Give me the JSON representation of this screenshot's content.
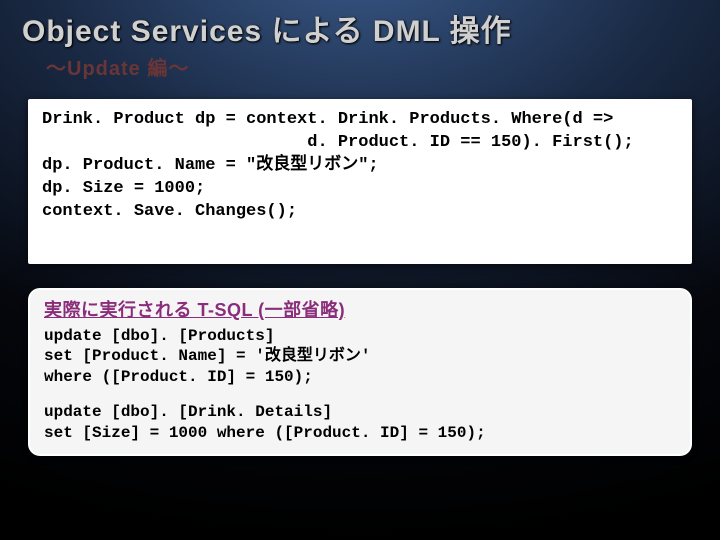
{
  "header": {
    "title": "Object Services による DML 操作",
    "subtitle": "～Update 編～"
  },
  "code_csharp": [
    "Drink. Product dp = context. Drink. Products. Where(d =>",
    "                          d. Product. ID == 150). First();",
    "dp. Product. Name = \"改良型リボン\";",
    "dp. Size = 1000;",
    "context. Save. Changes();"
  ],
  "tsql": {
    "caption": "実際に実行される T-SQL (一部省略)",
    "block1": [
      "update [dbo]. [Products]",
      "set [Product. Name] = '改良型リボン'",
      "where ([Product. ID] = 150);"
    ],
    "block2": [
      "update [dbo]. [Drink. Details]",
      "set [Size] = 1000 where ([Product. ID] = 150);"
    ]
  }
}
